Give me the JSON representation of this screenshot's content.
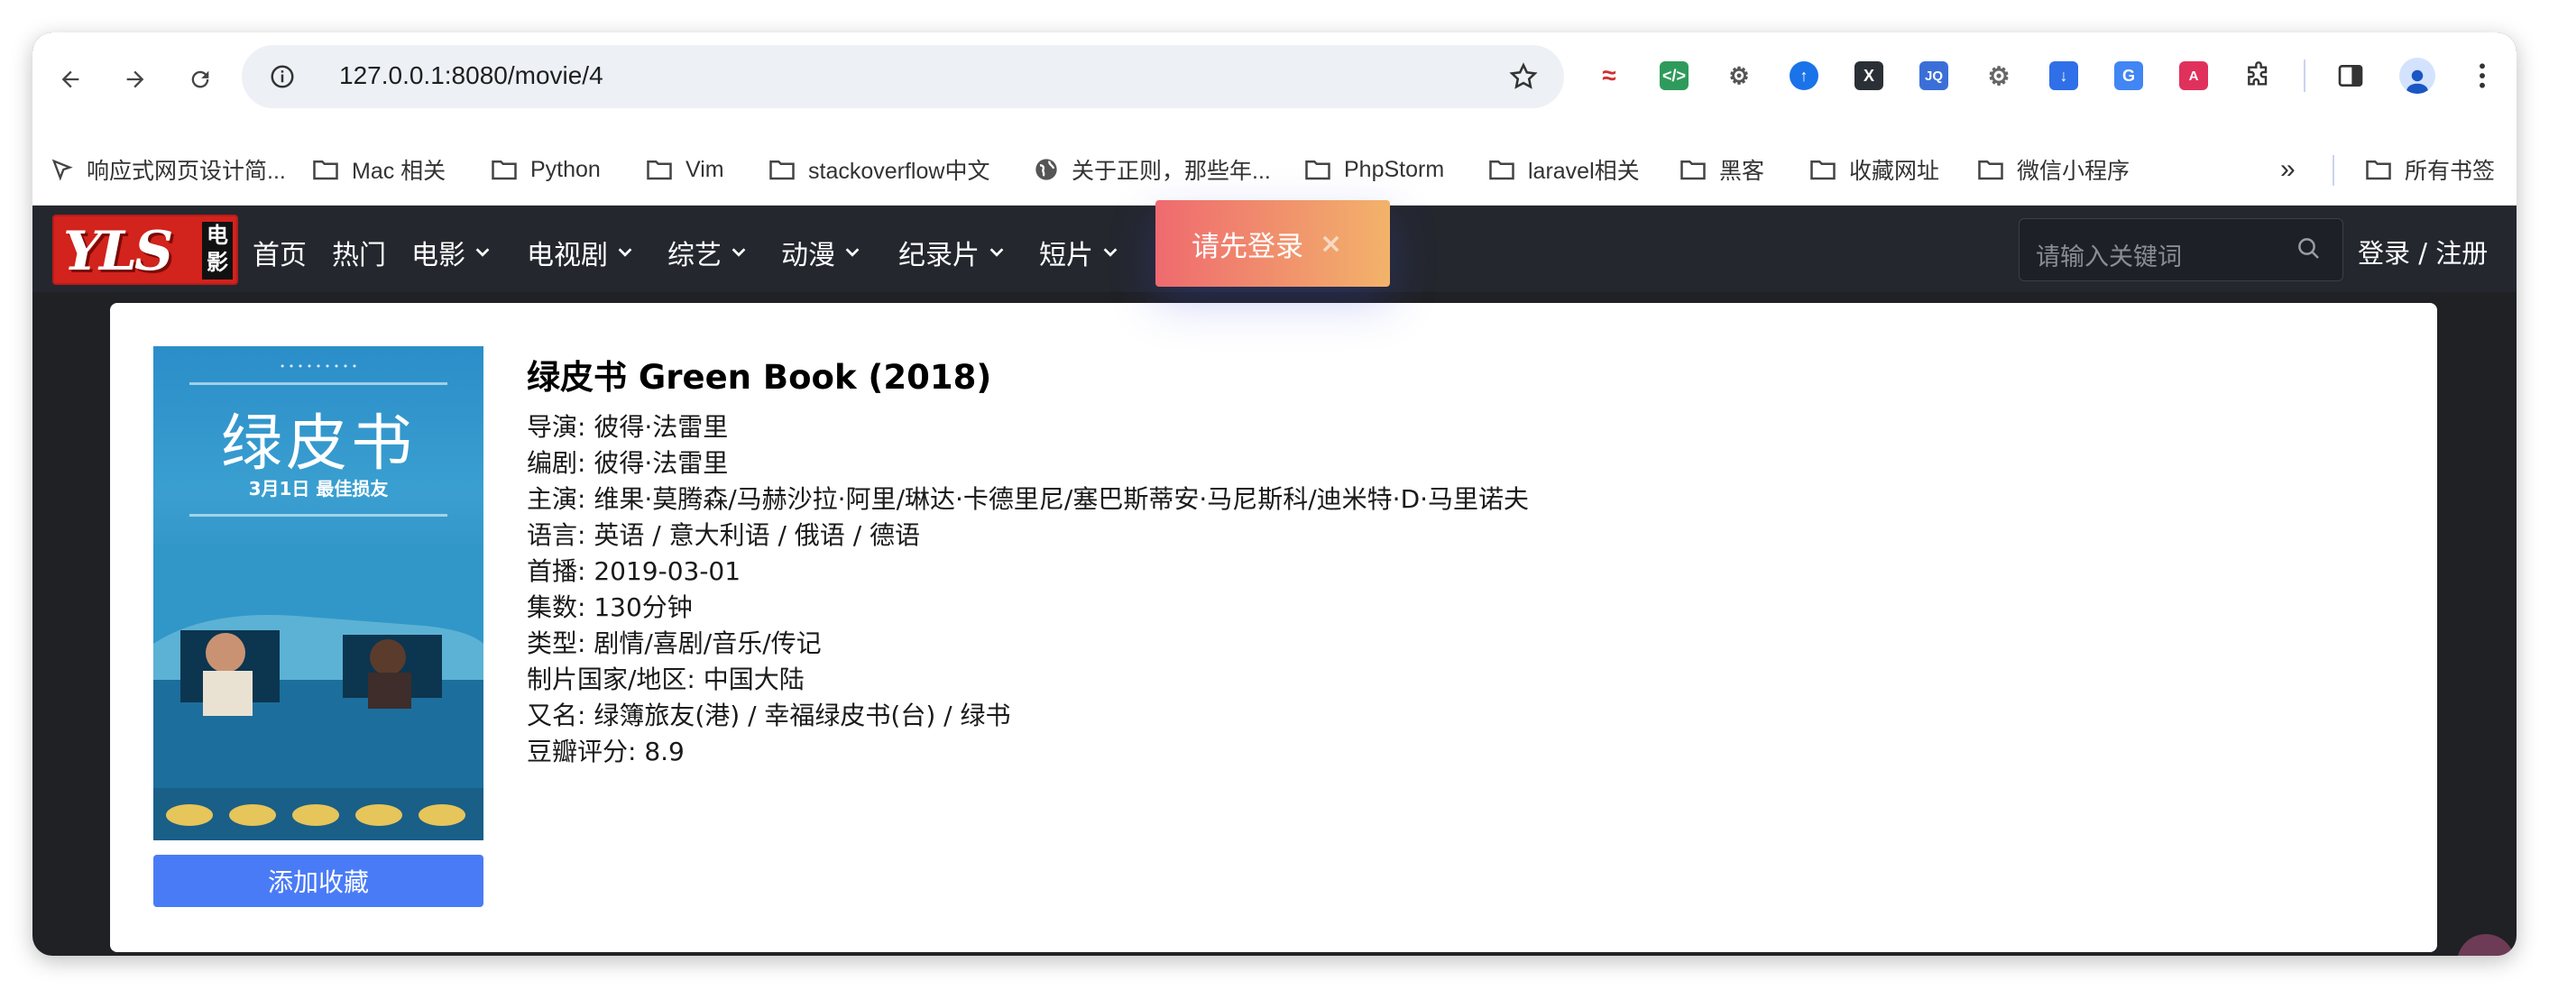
{
  "browser": {
    "url": "127.0.0.1:8080/movie/4"
  },
  "bookmarks": [
    {
      "label": "响应式网页设计简..."
    },
    {
      "label": "Mac 相关"
    },
    {
      "label": "Python"
    },
    {
      "label": "Vim"
    },
    {
      "label": "stackoverflow中文"
    },
    {
      "label": "关于正则，那些年..."
    },
    {
      "label": "PhpStorm"
    },
    {
      "label": "laravel相关"
    },
    {
      "label": "黑客"
    },
    {
      "label": "收藏网址"
    },
    {
      "label": "微信小程序"
    }
  ],
  "all_bookmarks": "所有书签",
  "site": {
    "logo_text": "YLS",
    "logo_side": "电影",
    "menu": [
      {
        "label": "首页"
      },
      {
        "label": "热门"
      },
      {
        "label": "电影"
      },
      {
        "label": "电视剧"
      },
      {
        "label": "综艺"
      },
      {
        "label": "动漫"
      },
      {
        "label": "纪录片"
      },
      {
        "label": "短片"
      }
    ],
    "search_placeholder": "请输入关键词",
    "login": "登录 / 注册"
  },
  "toast": {
    "text": "请先登录",
    "close": "×"
  },
  "poster": {
    "title": "绿皮书",
    "date": "3月1日  最佳损友"
  },
  "movie": {
    "title": "绿皮书 Green Book (2018)",
    "rows": [
      "导演: 彼得·法雷里",
      "编剧: 彼得·法雷里",
      "主演: 维果·莫腾森/马赫沙拉·阿里/琳达·卡德里尼/塞巴斯蒂安·马尼斯科/迪米特·D·马里诺夫",
      "语言: 英语 / 意大利语 / 俄语 / 德语",
      "首播: 2019-03-01",
      "集数: 130分钟",
      "类型: 剧情/喜剧/音乐/传记",
      "制片国家/地区: 中国大陆",
      "又名: 绿簿旅友(港) / 幸福绿皮书(台) / 绿书",
      "豆瓣评分: 8.9"
    ],
    "favorite_button": "添加收藏"
  }
}
